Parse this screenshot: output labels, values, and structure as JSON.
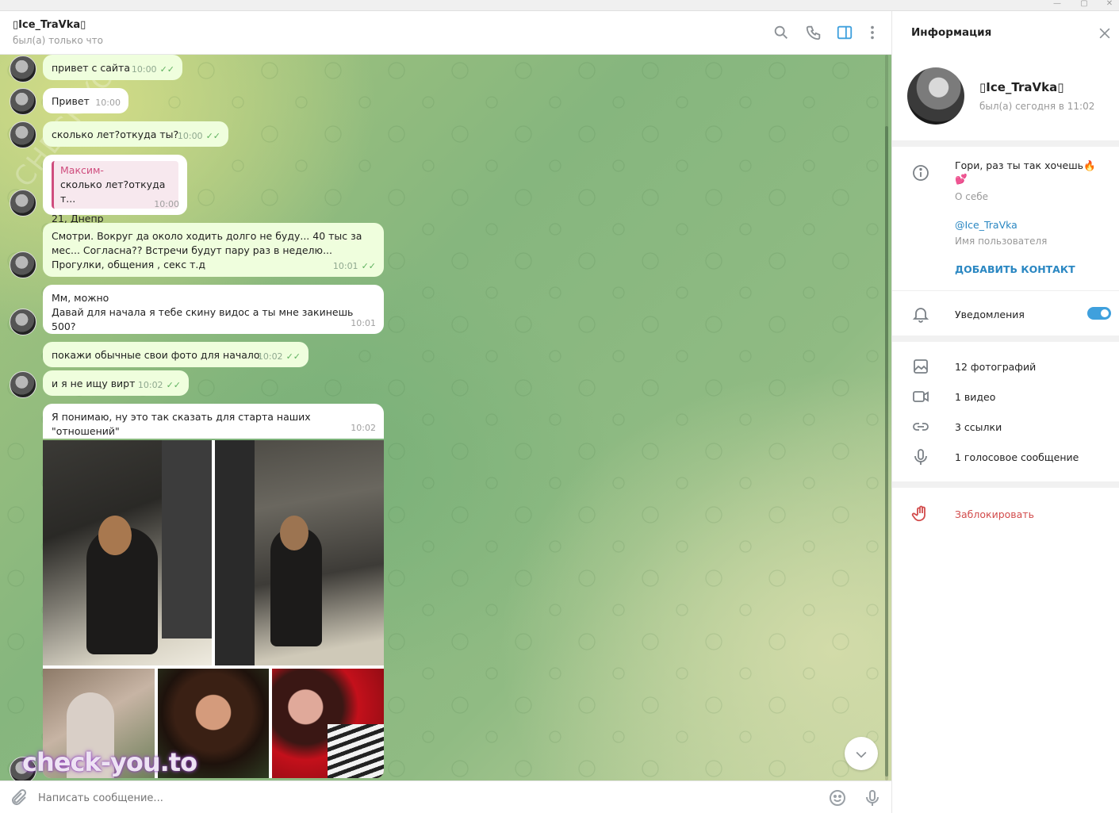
{
  "header": {
    "peer_name": "▯Ice_TraVka▯",
    "peer_status": "был(а) только что"
  },
  "messages": [
    {
      "text": "привет с сайта",
      "time": "10:00",
      "out": true
    },
    {
      "text": "Привет",
      "time": "10:00",
      "out": false
    },
    {
      "text": "сколько лет?откуда ты?",
      "time": "10:00",
      "out": true
    },
    {
      "reply_name": "Максим-",
      "reply_text": "сколько лет?откуда т...",
      "text": "21, Днепр",
      "time": "10:00",
      "out": false
    },
    {
      "text": "Смотри. Вокруг да около ходить долго не буду... 40 тыс  за мес... Согласна?? Встречи будут пару раз в неделю... Прогулки, общения , секс  т.д",
      "time": "10:01",
      "out": true
    },
    {
      "text": "Мм, можно\nДавай для начала я тебе скину видос а ты мне закинешь 500?",
      "time": "10:01",
      "out": false
    },
    {
      "text": "покажи обычные свои фото для начало",
      "time": "10:02",
      "out": true
    },
    {
      "text": "и я не ищу вирт",
      "time": "10:02",
      "out": true
    },
    {
      "text": "Я понимаю, ну это так сказать для старта наших \"отношений\"",
      "time": "10:02",
      "out": false
    }
  ],
  "composer": {
    "placeholder": "Написать сообщение..."
  },
  "watermark": {
    "main": "check-you.to",
    "diagonal": "CHECK-YOU.ME"
  },
  "info_panel": {
    "title": "Информация",
    "name": "▯Ice_TraVka▯",
    "status": "был(а) сегодня в 11:02",
    "bio": "Гори, раз ты так хочешь🔥💕",
    "bio_label": "О себе",
    "username": "@Ice_TraVka",
    "username_label": "Имя пользователя",
    "add_contact": "ДОБАВИТЬ КОНТАКТ",
    "notifications": "Уведомления",
    "notifications_on": true,
    "media": [
      {
        "label": "12 фотографий",
        "icon": "photo-icon"
      },
      {
        "label": "1 видео",
        "icon": "video-icon"
      },
      {
        "label": "3 ссылки",
        "icon": "link-icon"
      },
      {
        "label": "1 голосовое сообщение",
        "icon": "microphone-icon"
      }
    ],
    "block": "Заблокировать"
  }
}
